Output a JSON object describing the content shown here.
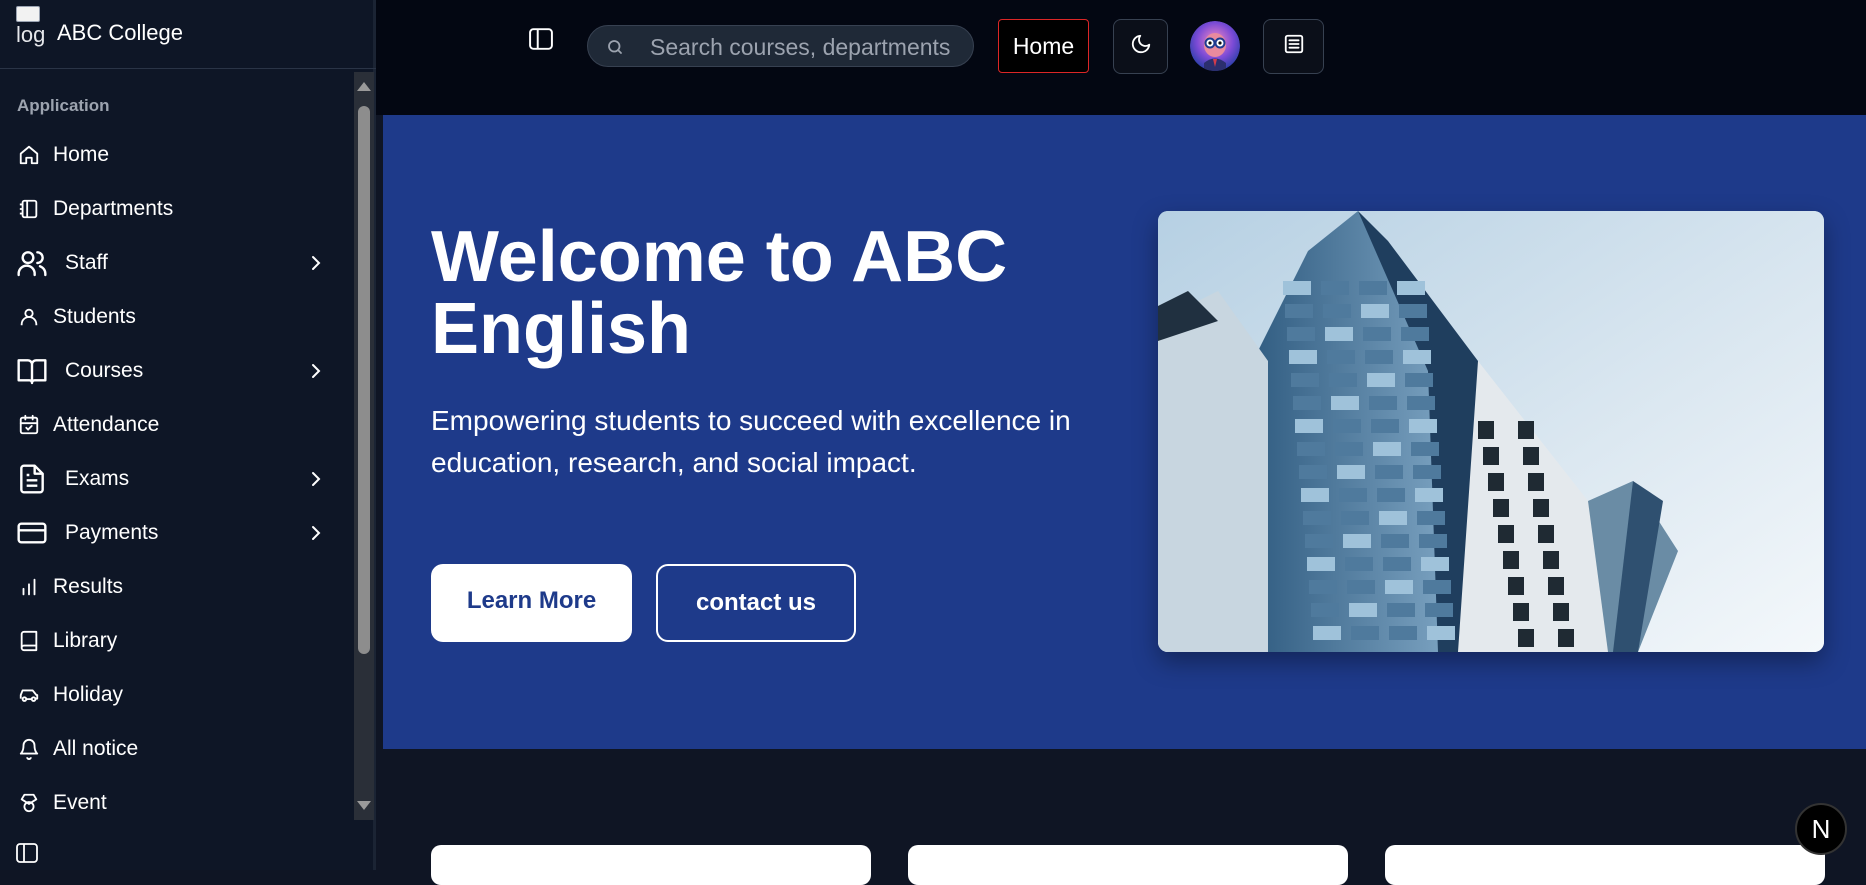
{
  "brand": {
    "logo_alt": "log",
    "name": "ABC College"
  },
  "sidebar": {
    "group_label": "Application",
    "items": [
      {
        "label": "Home",
        "icon": "home-icon"
      },
      {
        "label": "Departments",
        "icon": "notebook-icon"
      },
      {
        "label": "Staff",
        "icon": "users-icon",
        "has_submenu": true
      },
      {
        "label": "Students",
        "icon": "user-icon"
      },
      {
        "label": "Courses",
        "icon": "book-open-icon",
        "has_submenu": true
      },
      {
        "label": "Attendance",
        "icon": "calendar-check-icon"
      },
      {
        "label": "Exams",
        "icon": "file-text-icon",
        "has_submenu": true
      },
      {
        "label": "Payments",
        "icon": "credit-card-icon",
        "has_submenu": true
      },
      {
        "label": "Results",
        "icon": "bar-chart-icon"
      },
      {
        "label": "Library",
        "icon": "book-icon"
      },
      {
        "label": "Holiday",
        "icon": "car-icon"
      },
      {
        "label": "All notice",
        "icon": "bell-icon"
      },
      {
        "label": "Event",
        "icon": "award-icon"
      }
    ]
  },
  "header": {
    "search_placeholder": "Search courses, departments",
    "home_label": "Home"
  },
  "hero": {
    "title": "Welcome to ABC English",
    "subtitle": "Empowering students to succeed with excellence in education, research, and social impact.",
    "learn_more": "Learn More",
    "contact": "contact us"
  },
  "badge": {
    "letter": "N"
  },
  "colors": {
    "hero_bg": "#1e3a8a",
    "sidebar_bg": "#0e1626",
    "topbar_bg": "#030712",
    "home_border": "#dc2626"
  }
}
